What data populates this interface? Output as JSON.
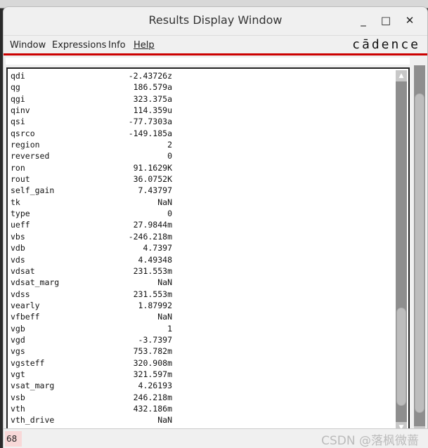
{
  "window": {
    "title": "Results Display Window",
    "minimize": "_",
    "maximize": "□",
    "close": "✕"
  },
  "menu": [
    "Window",
    "Expressions",
    "Info",
    "Help"
  ],
  "brand": "cādence",
  "rows": [
    [
      "qdi",
      "-2.43726z"
    ],
    [
      "qg",
      "186.579a"
    ],
    [
      "qgi",
      "323.375a"
    ],
    [
      "qinv",
      "114.359u"
    ],
    [
      "qsi",
      "-77.7303a"
    ],
    [
      "qsrco",
      "-149.185a"
    ],
    [
      "region",
      "2"
    ],
    [
      "reversed",
      "0"
    ],
    [
      "ron",
      "91.1629K"
    ],
    [
      "rout",
      "36.0752K"
    ],
    [
      "self_gain",
      "7.43797"
    ],
    [
      "tk",
      "NaN"
    ],
    [
      "type",
      "0"
    ],
    [
      "ueff",
      "27.9844m"
    ],
    [
      "vbs",
      "-246.218m"
    ],
    [
      "vdb",
      "4.7397"
    ],
    [
      "vds",
      "4.49348"
    ],
    [
      "vdsat",
      "231.553m"
    ],
    [
      "vdsat_marg",
      "NaN"
    ],
    [
      "vdss",
      "231.553m"
    ],
    [
      "vearly",
      "1.87992"
    ],
    [
      "vfbeff",
      "NaN"
    ],
    [
      "vgb",
      "1"
    ],
    [
      "vgd",
      "-3.7397"
    ],
    [
      "vgs",
      "753.782m"
    ],
    [
      "vgsteff",
      "320.908m"
    ],
    [
      "vgt",
      "321.597m"
    ],
    [
      "vsat_marg",
      "4.26193"
    ],
    [
      "vsb",
      "246.218m"
    ],
    [
      "vth",
      "432.186m"
    ],
    [
      "vth_drive",
      "NaN"
    ]
  ],
  "status": {
    "count": "68",
    "watermark": "CSDN @落枫微蔷"
  },
  "colors": {
    "accent": "#cc0000"
  }
}
